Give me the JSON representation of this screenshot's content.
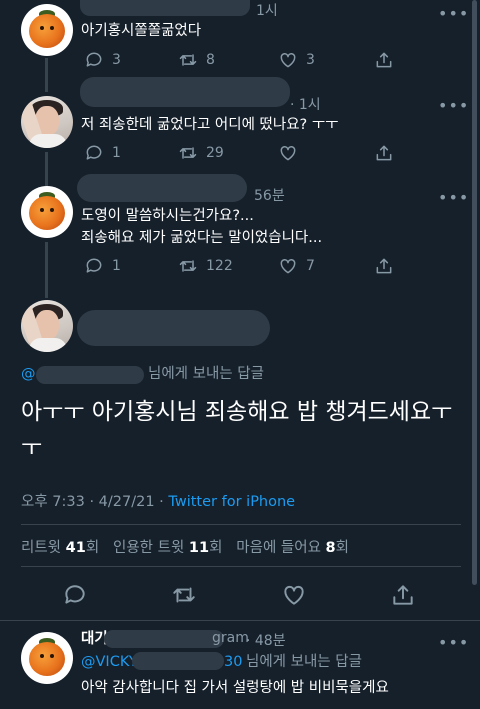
{
  "tweet1": {
    "time": "1시",
    "text": "아기홍시쫄쫄굶었다",
    "counts": {
      "reply": "3",
      "retweet": "8",
      "like": "3"
    }
  },
  "tweet2": {
    "time": "· 1시",
    "text": "저 죄송한데 굶었다고 어디에 떴나요? ㅜㅜ",
    "counts": {
      "reply": "1",
      "retweet": "29",
      "like": ""
    }
  },
  "tweet3": {
    "time": "56분",
    "lines": [
      "도영이 말씀하시는건가요?...",
      "죄송해요 제가 굶었다는 말이었습니다..."
    ],
    "counts": {
      "reply": "1",
      "retweet": "122",
      "like": "7"
    }
  },
  "main": {
    "mention_prefix": "@",
    "mention_suffix": "님에게 보내는 답글",
    "text": "아ㅜㅜ 아기홍시님 죄송해요 밥 챙겨드세요ㅜ ㅜ",
    "timestamp": "오후 7:33 · 4/27/21 ·",
    "source": "Twitter for iPhone",
    "stats": {
      "retweet_label": "리트윗",
      "retweet_count": "41",
      "retweet_unit": "회",
      "quote_label": "인용한 트윗",
      "quote_count": "11",
      "quote_unit": "회",
      "like_label": "마음에 들어요",
      "like_count": "8",
      "like_unit": "회"
    }
  },
  "reply": {
    "name_partial": "대기",
    "handle_partial": "gram",
    "time": "· 48분",
    "mention_partial": "@VICKY",
    "mention_partial_end": "30",
    "mention_suffix": "님에게 보내는 답글",
    "text": "아악 감사합니다 집 가서 설렁탕에 밥 비비묵을게요"
  },
  "icons": [
    "reply-icon",
    "retweet-icon",
    "like-icon",
    "share-icon",
    "more-icon"
  ],
  "colors": {
    "background": "#15202b",
    "secondary_text": "#8899a6",
    "link": "#1d9bf0",
    "divider": "#38444d"
  }
}
